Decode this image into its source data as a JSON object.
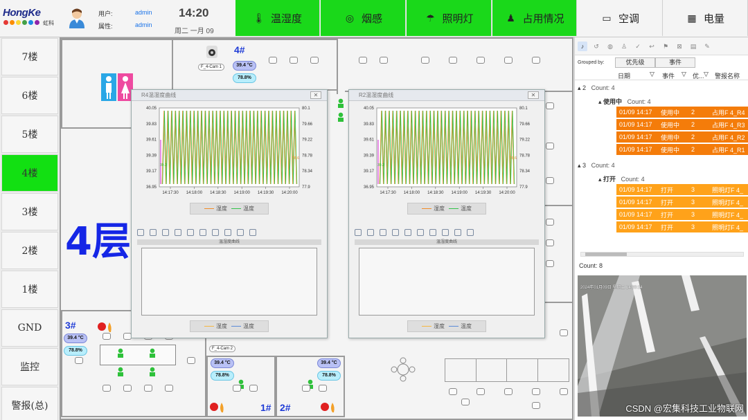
{
  "brand": {
    "logo": "HongKe",
    "logo_cn": "虹科",
    "dot_colors": [
      "#e53935",
      "#fb8c00",
      "#fdd835",
      "#43a047",
      "#1e88e5",
      "#8e24aa"
    ]
  },
  "user": {
    "user_label": "用户:",
    "user_value": "admin",
    "attr_label": "属性:",
    "attr_value": "admin"
  },
  "clock": {
    "time": "14:20",
    "date": "周二 一月 09"
  },
  "top_buttons": [
    {
      "label": "温湿度",
      "icon": "thermometer-icon",
      "active": true
    },
    {
      "label": "烟感",
      "icon": "smoke-detector-icon",
      "active": true
    },
    {
      "label": "照明灯",
      "icon": "lamp-icon",
      "active": true
    },
    {
      "label": "占用情况",
      "icon": "person-icon",
      "active": true
    },
    {
      "label": "空调",
      "icon": "air-conditioner-icon",
      "active": false
    },
    {
      "label": "电量",
      "icon": "meter-icon",
      "active": false
    }
  ],
  "floors": [
    "7楼",
    "6楼",
    "5楼",
    "4楼",
    "3楼",
    "2楼",
    "1楼",
    "GND",
    "监控",
    "警报(总)"
  ],
  "active_floor": "4楼",
  "plan": {
    "floor_title": "4层",
    "rooms": {
      "r4": {
        "num": "4#",
        "temp": "39.4 °C",
        "hum": "78.8%"
      },
      "r3": {
        "num": "3#",
        "temp": "39.4 °C",
        "hum": "78.8%"
      },
      "r1": {
        "num": "1#",
        "temp": "39.4 °C",
        "hum": "78.8%"
      },
      "r2": {
        "num": "2#",
        "temp": "39.4 °C",
        "hum": "78.8%"
      }
    },
    "cams": {
      "cam1": "F_4-Cam 1",
      "cam2": "F_4-Cam 2"
    }
  },
  "chart_windows": [
    {
      "title": "R4温湿度曲线",
      "subtitle": "温湿度曲线",
      "legend": [
        "湿度",
        "温度"
      ],
      "bottom_legend": [
        "湿度",
        "温度"
      ]
    },
    {
      "title": "R2温湿度曲线",
      "subtitle": "温湿度曲线",
      "legend": [
        "湿度",
        "温度"
      ],
      "bottom_legend": [
        "湿度",
        "温度"
      ]
    }
  ],
  "chart_data": [
    {
      "type": "line",
      "title": "",
      "x_ticks": [
        "14:17:30",
        "14:18:00",
        "14:18:30",
        "14:19:00",
        "14:19:30",
        "14:20:00"
      ],
      "y_left_ticks": [
        "40.05",
        "39.83",
        "39.61",
        "39.39",
        "39.17",
        "36.95"
      ],
      "y_right_ticks": [
        "80.1",
        "79.66",
        "79.22",
        "78.78",
        "78.34",
        "77.9"
      ],
      "left_marker": "39.2",
      "right_marker": "78.6",
      "series": [
        {
          "name": "湿度",
          "color": "#f28c28",
          "pattern": "sawtooth",
          "min": 77.9,
          "max": 80.1,
          "periods": 36
        },
        {
          "name": "温度",
          "color": "#34c34a",
          "pattern": "sawtooth",
          "min": 36.95,
          "max": 40.05,
          "periods": 36
        }
      ]
    },
    {
      "type": "line",
      "title": "",
      "x_ticks": [
        "14:17:30",
        "14:18:00",
        "14:18:30",
        "14:19:00",
        "14:19:30",
        "14:20:00"
      ],
      "y_left_ticks": [
        "40.05",
        "39.83",
        "39.61",
        "39.39",
        "39.17",
        "36.95"
      ],
      "y_right_ticks": [
        "80.1",
        "79.66",
        "79.22",
        "78.78",
        "78.34",
        "77.9"
      ],
      "left_marker": "39.2",
      "right_marker": "78.6",
      "series": [
        {
          "name": "湿度",
          "color": "#f28c28",
          "pattern": "sawtooth",
          "min": 77.9,
          "max": 80.1,
          "periods": 36
        },
        {
          "name": "温度",
          "color": "#34c34a",
          "pattern": "sawtooth",
          "min": 36.95,
          "max": 40.05,
          "periods": 36
        }
      ]
    }
  ],
  "events": {
    "grouped_by_label": "Grouped by:",
    "group_chips": [
      "优先级",
      "事件"
    ],
    "columns": [
      "日期",
      "事件",
      "优...",
      "警报名称"
    ],
    "groups": [
      {
        "key": "2",
        "count": "Count: 4",
        "sub": "使用中",
        "sub_count": "Count: 4",
        "color": "#f47c0a",
        "rows": [
          [
            "01/09 14:17",
            "使用中",
            "2",
            "占用F 4_R4"
          ],
          [
            "01/09 14:17",
            "使用中",
            "2",
            "占用F 4_R3"
          ],
          [
            "01/09 14:17",
            "使用中",
            "2",
            "占用F 4_R2"
          ],
          [
            "01/09 14:17",
            "使用中",
            "2",
            "占用F 4_R1"
          ]
        ]
      },
      {
        "key": "3",
        "count": "Count: 4",
        "sub": "打开",
        "sub_count": "Count: 4",
        "color": "#ffa21a",
        "rows": [
          [
            "01/09 14:17",
            "打开",
            "3",
            "照明灯F 4_"
          ],
          [
            "01/09 14:17",
            "打开",
            "3",
            "照明灯F 4_"
          ],
          [
            "01/09 14:17",
            "打开",
            "3",
            "照明灯F 4_"
          ],
          [
            "01/09 14:17",
            "打开",
            "3",
            "照明灯F 4_"
          ]
        ]
      }
    ],
    "total": "Count: 8"
  },
  "video": {
    "overlay": "2024年01月09日 星期二 14:20:14",
    "watermark": "CSDN @宏集科技工业物联网"
  }
}
